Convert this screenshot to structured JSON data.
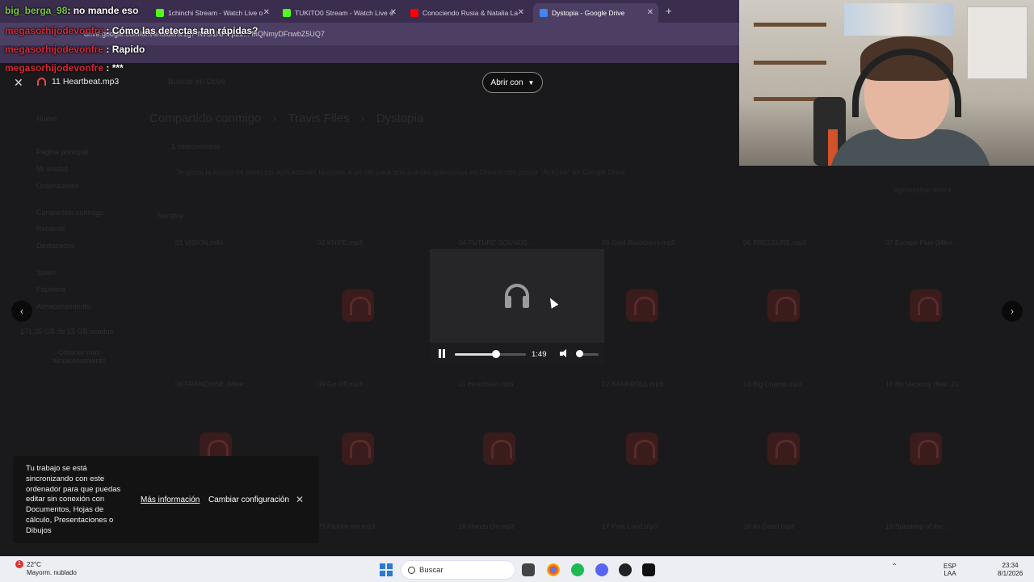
{
  "browser": {
    "tabs": [
      {
        "title": "1chinchi Stream - Watch Live o",
        "color": "#53fc18"
      },
      {
        "title": "TUKITO0 Stream - Watch Live o",
        "color": "#53fc18"
      },
      {
        "title": "Conociendo Rusia & Natalia La",
        "color": "#ff0000"
      },
      {
        "title": "Dystopia - Google Drive",
        "color": "#4285f4"
      }
    ],
    "url": "drive.google.com/drive/folders/1g7-fWG1NP...pZz... MQNmyDFnwbZ5UQ7"
  },
  "drive": {
    "search_placeholder": "Buscar en Drive",
    "new_label": "Nuevo",
    "sidebar": [
      "Página principal",
      "Mi unidad",
      "Ordenadores",
      "Compartido conmigo",
      "Reciente",
      "Destacados",
      "Spam",
      "Papelera",
      "Almacenamiento"
    ],
    "storage_text": "171,35 GB de 15 GB usados",
    "storage_button": "Obtener más almacenamiento",
    "breadcrumb": [
      "Compartido conmigo",
      "Travis Files",
      "Dystopia"
    ],
    "toolbar_label": "1 seleccionado",
    "banner": "Te gusta la ilusión de tener tus aplicaciones favoritas a un clic para que puedas guardarlas en Drive o con pulsar \"Aceptar\" en Google Drive.",
    "banner_action": "Aprovechar ahora",
    "sort_label": "Nombre",
    "files_row1": [
      "01 VISION.m4a",
      "02 KNIFE.mp3",
      "04 FUTURE SOUNDS...",
      "05 Gold Blackberry.mp3",
      "06 PRESSURE.mp3",
      "07 Escape Plan (Mike..."
    ],
    "files_row2": [
      "08 FRANCHISE (Mike...",
      "09 Go Off.mp3",
      "11 Heartbeat.mp3",
      "12 BANKROLL.mp3",
      "13 Big Champ.mp3",
      "14 No Vacancy (feat. 21..."
    ],
    "files_row3": [
      "",
      "",
      "16 Hands On.mp3",
      "17 Park Lood.mp3",
      "18 Im Good.mp3",
      "19 Speaking of the...",
      "20 Picture me.mp3"
    ]
  },
  "viewer": {
    "file_name": "11 Heartbeat.mp3",
    "open_with": "Abrir con",
    "time": "1:49",
    "progress": 0.58,
    "volume": 0.05
  },
  "toast": {
    "text": "Tu trabajo se está sincronizando con este ordenador para que puedas editar sin conexión con Documentos, Hojas de cálculo, Presentaciones o Dibujos",
    "link": "Más información",
    "button": "Cambiar configuración"
  },
  "chat": [
    {
      "user": "big_berga_98",
      "user_color": "#7ac943",
      "message": "no mande eso"
    },
    {
      "user": "megasorhijodevonfre",
      "user_color": "#d02a3a",
      "message": "Cómo las detectas tan rápidas?"
    },
    {
      "user": "megasorhijodevonfre",
      "user_color": "#d02a3a",
      "message": "Rapido"
    },
    {
      "user": "megasorhijodevonfre",
      "user_color": "#d02a3a",
      "message": "***"
    }
  ],
  "taskbar": {
    "temp": "22°C",
    "weather": "Mayorm. nublado",
    "weather_badge": "1",
    "search": "Buscar",
    "lang1": "ESP",
    "lang2": "LAA",
    "time": "23:34",
    "date": "8/1/2026"
  }
}
